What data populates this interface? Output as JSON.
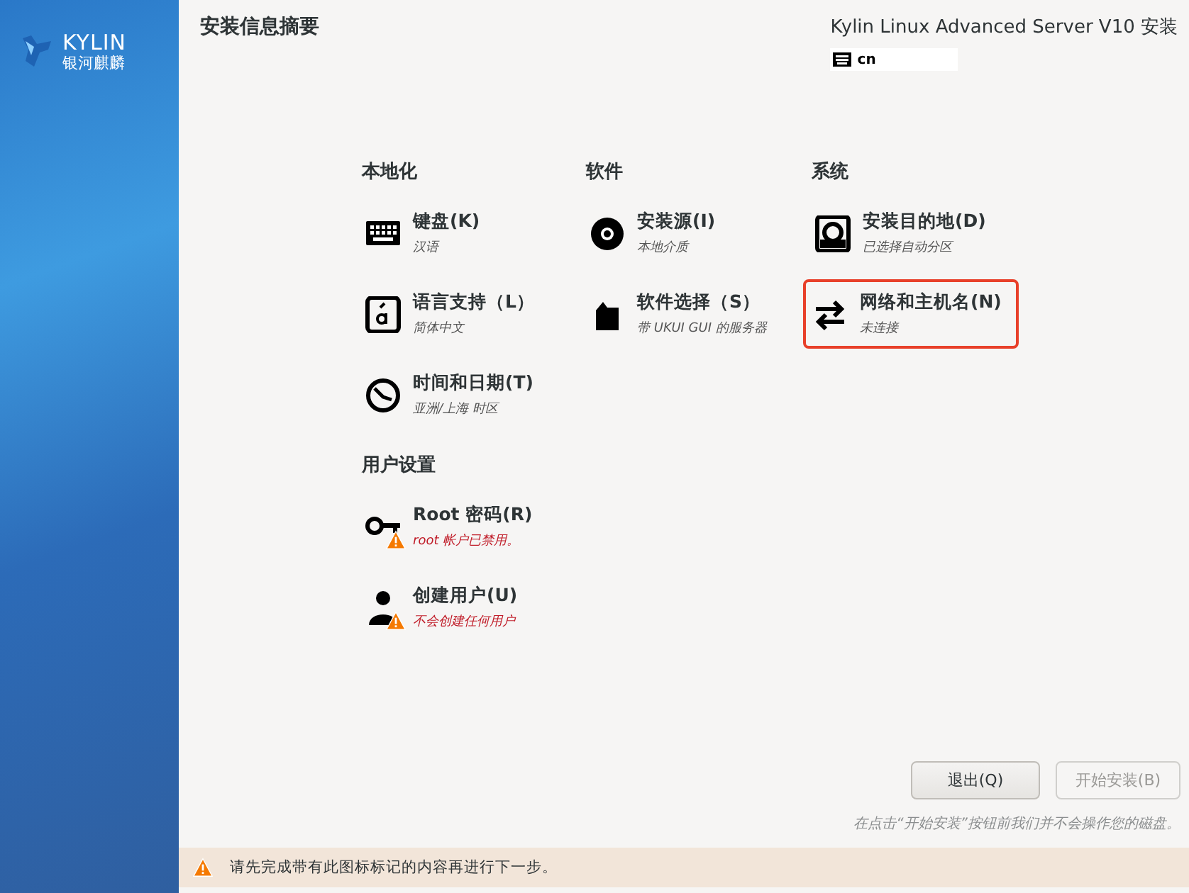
{
  "sidebar": {
    "logo_text": "KYLIN",
    "logo_subtext": "银河麒麟"
  },
  "header": {
    "title": "安装信息摘要",
    "product": "Kylin Linux Advanced Server V10 安装",
    "keyboard_layout": "cn"
  },
  "sections": [
    {
      "title": "本地化",
      "items": [
        {
          "label": "键盘(K)",
          "status": "汉语",
          "warning": false,
          "selected": false
        },
        {
          "label": "语言支持（L）",
          "status": "简体中文",
          "warning": false,
          "selected": false
        },
        {
          "label": "时间和日期(T)",
          "status": "亚洲/上海 时区",
          "warning": false,
          "selected": false
        }
      ]
    },
    {
      "title": "软件",
      "items": [
        {
          "label": "安装源(I)",
          "status": "本地介质",
          "warning": false,
          "selected": false
        },
        {
          "label": "软件选择（S）",
          "status": "带 UKUI GUI 的服务器",
          "warning": false,
          "selected": false
        }
      ]
    },
    {
      "title": "系统",
      "items": [
        {
          "label": "安装目的地(D)",
          "status": "已选择自动分区",
          "warning": false,
          "selected": false
        },
        {
          "label": "网络和主机名(N)",
          "status": "未连接",
          "warning": false,
          "selected": true
        }
      ]
    },
    {
      "title": "用户设置",
      "items": [
        {
          "label": "Root 密码(R)",
          "status": "root 帐户已禁用。",
          "warning": true,
          "selected": false
        },
        {
          "label": "创建用户(U)",
          "status": "不会创建任何用户",
          "warning": true,
          "selected": false
        }
      ]
    }
  ],
  "buttons": [
    {
      "label": "退出(Q)",
      "disabled": false
    },
    {
      "label": "开始安装(B)",
      "disabled": true
    }
  ],
  "note": "在点击“开始安装”按钮前我们并不会操作您的磁盘。",
  "warning_bar": "请先完成带有此图标标记的内容再进行下一步。"
}
